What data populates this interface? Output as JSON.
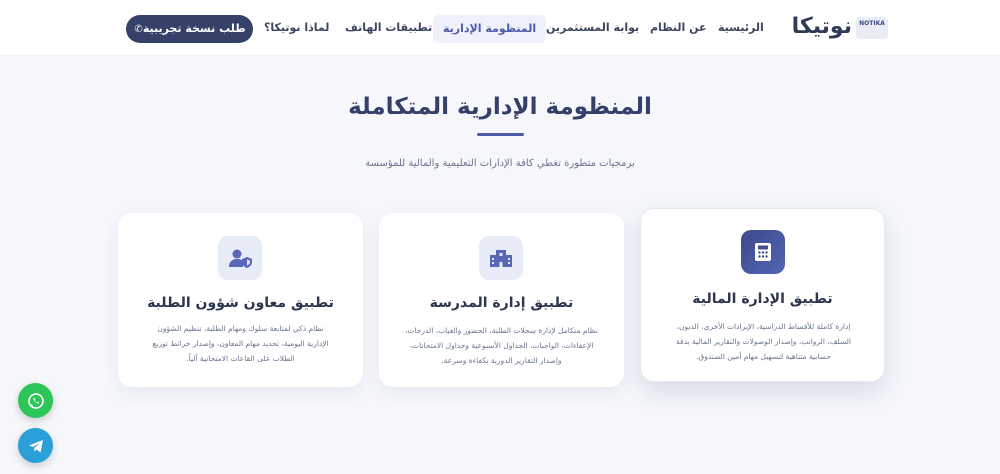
{
  "nav": {
    "logo_text": "نوتيكا",
    "logo_badge": "NOTIKA",
    "links": [
      {
        "label": "الرئيسية"
      },
      {
        "label": "عن النظام"
      },
      {
        "label": "بوابة المستثمرين"
      },
      {
        "label": "المنظومة الإدارية"
      },
      {
        "label": "تطبيقات الهاتف"
      },
      {
        "label": "لماذا نوتيكا؟"
      }
    ],
    "active_index": 3,
    "cta_label": "طلب نسخة تجريبية"
  },
  "hero": {
    "title": "المنظومة الإدارية المتكاملة",
    "subtitle": "برمجيات متطورة تغطي كافة الإدارات التعليمية والمالية للمؤسسة"
  },
  "cards": [
    {
      "title": "تطبيق الإدارة المالية",
      "icon": "calculator-icon",
      "desc_lines": [
        "إدارة كاملة للأقساط الدراسية، الإيرادات الأخرى، الديون،",
        "السلف، الرواتب، وإصدار الوصولات والتقارير المالية بدقة",
        "حسابية متناهية لتسهيل مهام أمين الصندوق."
      ]
    },
    {
      "title": "تطبيق إدارة المدرسة",
      "icon": "school-building-icon",
      "desc_lines": [
        "نظام متكامل لإدارة سجلات الطلبة، الحضور والغياب، الدرجات،",
        "الإعفاءات، الواجبات، الجداول الأسبوعية وجداول الامتحانات،",
        "وإصدار التقارير الدورية بكفاءة وسرعة."
      ]
    },
    {
      "title": "تطبيق معاون شؤون الطلبة",
      "icon": "user-shield-icon",
      "desc_lines": [
        "نظام ذكي لمتابعة سلوك ومهام الطلبة، تنظيم الشؤون",
        "الإدارية اليومية، تحديد مهام المعاون، وإصدار خرائط توزيع",
        "الطلاب على القاعات الامتحانية آلياً."
      ]
    }
  ],
  "floating": {
    "whatsapp_icon": "whatsapp-icon",
    "telegram_icon": "telegram-icon"
  },
  "colors": {
    "brand_dark": "#36416a",
    "accent": "#4e5aa8",
    "background": "#f5f7fb",
    "whatsapp": "#2bc657",
    "telegram": "#2a9fd8"
  }
}
